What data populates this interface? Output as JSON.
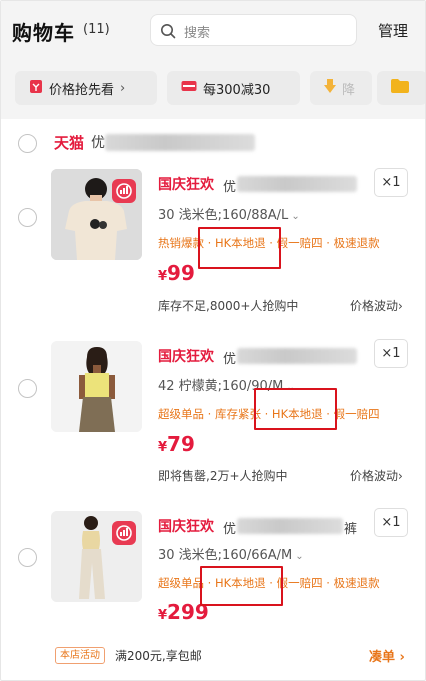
{
  "header": {
    "title": "购物车",
    "count": "(11)",
    "search_placeholder": "搜索",
    "manage_label": "管理"
  },
  "filters": [
    {
      "label": "价格抢先看",
      "icon": "price-tag-icon"
    },
    {
      "label": "每300减30",
      "icon": "coupon-icon"
    },
    {
      "label": "降",
      "icon": "price-drop-icon"
    },
    {
      "label": "",
      "icon": "folder-icon"
    }
  ],
  "store": {
    "name": "天猫",
    "name_tail": "优"
  },
  "products": [
    {
      "tag": "国庆狂欢",
      "name_tail": "优",
      "qty": "×1",
      "sku": "30 浅米色;160/88A/L",
      "promo": "热销爆款 · HK本地退 · 假一赔四 · 极速退款",
      "price_symbol": "¥",
      "price": "99",
      "stock": "库存不足,8000+人抢购中",
      "price_wave": "价格波动",
      "thumb_bg": "#dcdcdc"
    },
    {
      "tag": "国庆狂欢",
      "name_tail": "优",
      "qty": "×1",
      "sku": "42 柠檬黄;160/90/M",
      "promo": "超级单品 · 库存紧张 · HK本地退 · 假一赔四",
      "price_symbol": "¥",
      "price": "79",
      "stock": "即将售罄,2万+人抢购中",
      "price_wave": "价格波动",
      "thumb_bg": "#f3f3f3"
    },
    {
      "tag": "国庆狂欢",
      "name_tail": "优",
      "name_suffix": "裤",
      "qty": "×1",
      "sku": "30 浅米色;160/66A/M",
      "promo": "超级单品 · HK本地退 · 假一赔四 · 极速退款",
      "price_symbol": "¥",
      "price": "299",
      "stock": "",
      "price_wave": "",
      "thumb_bg": "#eeeeee"
    }
  ],
  "footer": {
    "shop_activity": "本店活动",
    "shipping": "满200元,享包邮",
    "add_more": "凑单"
  },
  "colors": {
    "accent_red": "#e41b3d",
    "promo_orange": "#e8761a",
    "highlight_box": "#d9131d"
  }
}
